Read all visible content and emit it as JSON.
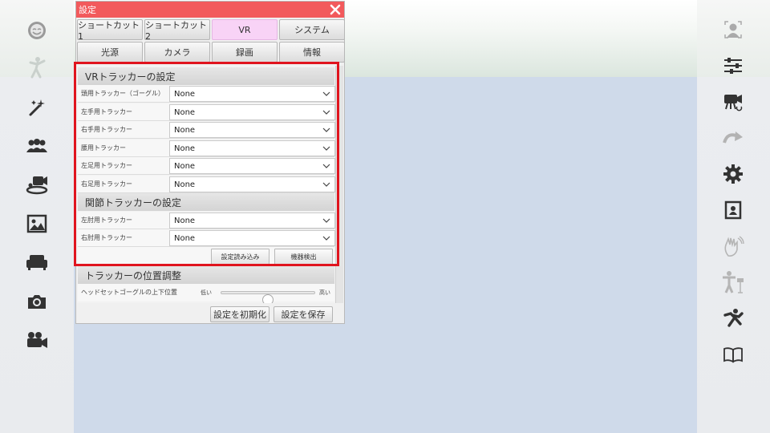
{
  "window": {
    "title": "設定",
    "close_icon": "close-icon"
  },
  "tabs_row1": [
    "ショートカット1",
    "ショートカット2",
    "VR",
    "システム"
  ],
  "tabs_row2": [
    "光源",
    "カメラ",
    "録画",
    "情報"
  ],
  "active_tab": "VR",
  "vr_section": {
    "title": "VRトラッカーの設定",
    "rows": [
      {
        "label": "頭用トラッカー（ゴーグル）",
        "value": "None"
      },
      {
        "label": "左手用トラッカー",
        "value": "None"
      },
      {
        "label": "右手用トラッカー",
        "value": "None"
      },
      {
        "label": "腰用トラッカー",
        "value": "None"
      },
      {
        "label": "左足用トラッカー",
        "value": "None"
      },
      {
        "label": "右足用トラッカー",
        "value": "None"
      }
    ]
  },
  "joint_section": {
    "title": "関節トラッカーの設定",
    "rows": [
      {
        "label": "左肘用トラッカー",
        "value": "None"
      },
      {
        "label": "右肘用トラッカー",
        "value": "None"
      }
    ],
    "load_button": "設定読み込み",
    "detect_button": "機器検出"
  },
  "position_section": {
    "title": "トラッカーの位置調整",
    "slider_label": "ヘッドセットゴーグルの上下位置",
    "low_label": "低い",
    "high_label": "高い",
    "slider_value": 0.5
  },
  "footer": {
    "reset_button": "設定を初期化",
    "save_button": "設定を保存"
  },
  "colors": {
    "titlebar": "#f25a5c",
    "active_tab": "#f8d3f6",
    "highlight": "#e0141e",
    "background": "#cfdaea"
  },
  "left_toolbar": [
    "smile-face-icon",
    "dance-pose-icon",
    "magic-wand-icon",
    "group-icon",
    "stage-camera-icon",
    "image-icon",
    "sofa-icon",
    "camera-icon",
    "video-camera-icon"
  ],
  "right_toolbar": [
    "portrait-icon",
    "sliders-icon",
    "video-record-icon",
    "redo-arrow-icon",
    "gear-icon",
    "id-card-icon",
    "hand-wave-icon",
    "tpose-camera-icon",
    "running-person-icon",
    "book-icon"
  ]
}
